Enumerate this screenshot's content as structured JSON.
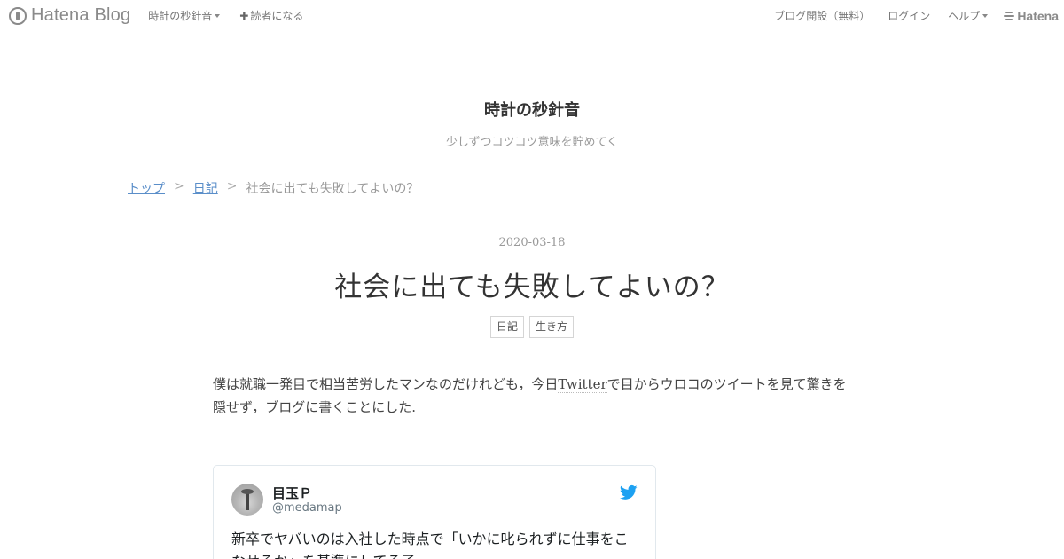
{
  "globalheader": {
    "brand": "Hatena Blog",
    "blog_menu": "時計の秒針音",
    "subscribe": "読者になる",
    "create_blog": "ブログ開設（無料）",
    "login": "ログイン",
    "help": "ヘルプ",
    "hatena": "Hatena"
  },
  "blog": {
    "title": "時計の秒針音",
    "description": "少しずつコツコツ意味を貯めてく"
  },
  "breadcrumb": {
    "items": [
      "トップ",
      "日記",
      "社会に出ても失敗してよいの？"
    ],
    "separator": ">"
  },
  "entry": {
    "date": "2020-03-18",
    "title": "社会に出ても失敗してよいの？",
    "categories": [
      "日記",
      "生き方"
    ],
    "body_before": "僕は就職一発目で相当苦労したマンなのだけれども，今日",
    "body_keyword": "Twitter",
    "body_after": "で目からウロコのツイートを見て驚きを隠せず，ブログに書くことにした."
  },
  "tweet": {
    "name": "目玉Ｐ",
    "handle": "@medamap",
    "text": "新卒でヤバいのは入社した時点で「いかに叱られずに仕事をこなせるか」を基準にしてる子",
    "bird_color": "#1da1f2"
  }
}
